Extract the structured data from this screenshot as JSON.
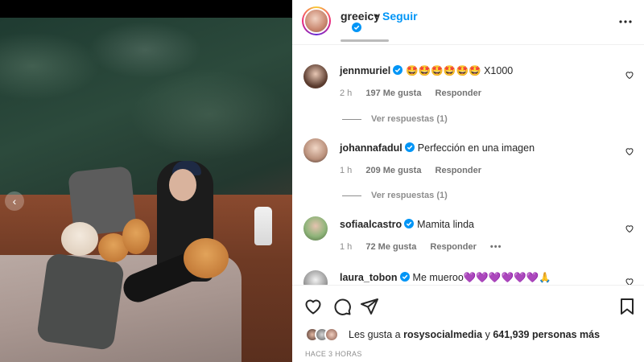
{
  "post": {
    "username": "greeicy",
    "separator": "•",
    "follow_label": "Seguir",
    "more_icon": "more-horizontal-icon"
  },
  "comments": [
    {
      "user": "jennmuriel",
      "verified": true,
      "text": "🤩🤩🤩🤩🤩🤩 X1000",
      "time": "2 h",
      "likes": "197 Me gusta",
      "reply": "Responder",
      "view_replies": "Ver respuestas (1)"
    },
    {
      "user": "johannafadul",
      "verified": true,
      "text": "Perfección en una imagen",
      "time": "1 h",
      "likes": "209 Me gusta",
      "reply": "Responder",
      "view_replies": "Ver respuestas (1)"
    },
    {
      "user": "sofiaalcastro",
      "verified": true,
      "text": "Mamita linda",
      "time": "1 h",
      "likes": "72 Me gusta",
      "reply": "Responder",
      "options": "•••"
    },
    {
      "user": "laura_tobon",
      "verified": true,
      "text": "Me mueroo💜💜💜💜💜💜🙏"
    }
  ],
  "footer": {
    "likes_prefix": "Les gusta a",
    "liked_by": "rosysocialmedia",
    "likes_middle": "y",
    "likes_count": "641,939 personas más",
    "time_ago": "HACE 3 HORAS"
  },
  "colors": {
    "accent": "#0095f6",
    "verified": "#0095f6",
    "text": "#262626",
    "muted": "#8e8e8e"
  }
}
